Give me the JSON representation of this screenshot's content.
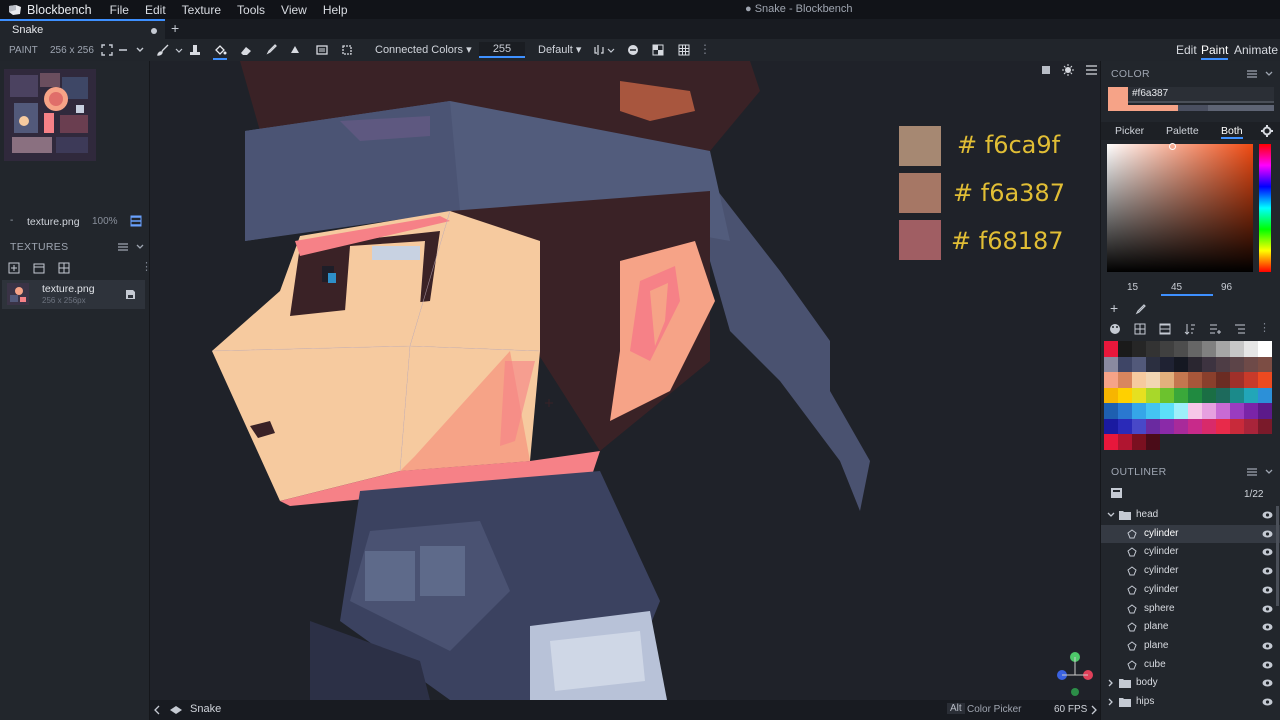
{
  "app": {
    "brand": "Blockbench",
    "window_title": "● Snake - Blockbench",
    "menus": [
      "File",
      "Edit",
      "Texture",
      "Tools",
      "View",
      "Help"
    ]
  },
  "tabs": [
    {
      "label": "Snake"
    }
  ],
  "toolbar": {
    "mode_label": "PAINT",
    "size_label": "256 x 256",
    "fill_mode": "Connected Colors",
    "opacity_value": "255",
    "brush_preset": "Default",
    "modes": [
      "Edit",
      "Paint",
      "Animate"
    ],
    "active_mode": "Paint"
  },
  "left": {
    "texture_name": "texture.png",
    "zoom": "100%",
    "textures_header": "TEXTURES",
    "texture_item": {
      "name": "texture.png",
      "size": "256 x 256px"
    }
  },
  "viewport": {
    "hex_overlays": [
      {
        "label": "# f6ca9f",
        "color": "#a68872"
      },
      {
        "label": "# f6a387",
        "color": "#a67765"
      },
      {
        "label": "# f68187",
        "color": "#a05e63"
      }
    ]
  },
  "status": {
    "project": "Snake",
    "modifier_key": "Alt",
    "hint": "Color Picker",
    "fps": "60 FPS"
  },
  "color_panel": {
    "header": "COLOR",
    "hex_value": "#f6a387",
    "current_color": "#f6a387",
    "tabs": [
      "Picker",
      "Palette",
      "Both"
    ],
    "active_tab": "Both",
    "hsv": {
      "h": "15",
      "s": "45",
      "v": "96"
    }
  },
  "outliner": {
    "header": "OUTLINER",
    "count": "1/22",
    "items": [
      {
        "type": "folder",
        "name": "head",
        "open": true
      },
      {
        "type": "mesh",
        "name": "cylinder",
        "selected": true
      },
      {
        "type": "mesh",
        "name": "cylinder"
      },
      {
        "type": "mesh",
        "name": "cylinder"
      },
      {
        "type": "mesh",
        "name": "cylinder"
      },
      {
        "type": "mesh",
        "name": "sphere"
      },
      {
        "type": "mesh",
        "name": "plane"
      },
      {
        "type": "mesh",
        "name": "plane"
      },
      {
        "type": "mesh",
        "name": "cube"
      },
      {
        "type": "folder",
        "name": "body",
        "open": false
      },
      {
        "type": "folder",
        "name": "hips",
        "open": false
      }
    ]
  },
  "palette_colors": [
    "#e8173b",
    "#1a1a1a",
    "#262626",
    "#333333",
    "#404040",
    "#4d4d4d",
    "#666666",
    "#808080",
    "#a6a6a6",
    "#c7c7c7",
    "#e6e6e6",
    "#ffffff",
    "#8a8aa0",
    "#3e4566",
    "#52597a",
    "#2b2f40",
    "#1f2233",
    "#151822",
    "#2a2630",
    "#3d3340",
    "#4e3d45",
    "#5c4448",
    "#6e4a48",
    "#7c4d44",
    "#f6a387",
    "#d9865e",
    "#f6ca9f",
    "#f2d6b3",
    "#e2b07d",
    "#c4774f",
    "#a8573a",
    "#8a3f2c",
    "#6b2c23",
    "#a0302a",
    "#c83a2a",
    "#ee4a20",
    "#f7b500",
    "#ffd000",
    "#e6e020",
    "#a8d82a",
    "#6cc22e",
    "#3aa83a",
    "#208a40",
    "#1a6e44",
    "#1d6a5c",
    "#1b8a8a",
    "#22a6b8",
    "#2c90d8",
    "#1e5fb0",
    "#2a78d0",
    "#35a6e8",
    "#44c4f2",
    "#5ce0f8",
    "#9ef0fa",
    "#f6c8e8",
    "#e6a0e0",
    "#c86ad4",
    "#9a3cc0",
    "#7a24a8",
    "#5c1a8a",
    "#1a1aa0",
    "#2a2ab8",
    "#4848c8",
    "#6a2aa0",
    "#8a2aa8",
    "#a82a9a",
    "#c82a8a",
    "#d82a6a",
    "#e82a4a",
    "#c82a3a",
    "#a8243a",
    "#7a1a2a",
    "#e8173b",
    "#b01530",
    "#7a1020",
    "#4a0c18"
  ]
}
